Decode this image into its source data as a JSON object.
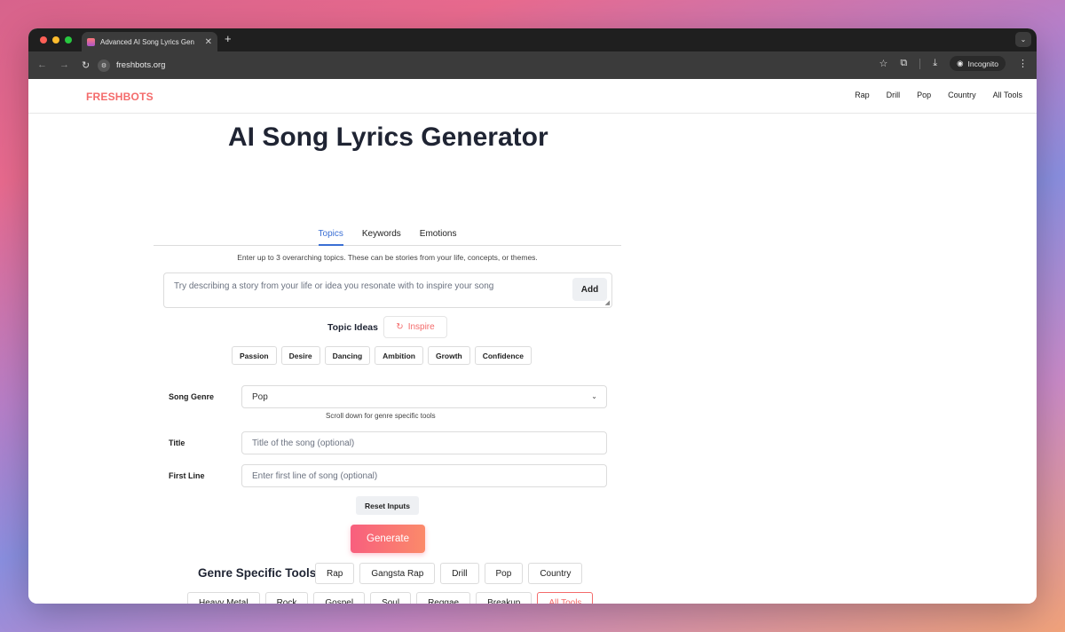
{
  "browser": {
    "tab_title": "Advanced AI Song Lyrics Gen",
    "url": "freshbots.org",
    "incognito_label": "Incognito"
  },
  "site": {
    "logo": "FRESHBOTS",
    "nav": [
      "Rap",
      "Drill",
      "Pop",
      "Country",
      "All Tools"
    ]
  },
  "page": {
    "title": "AI Song Lyrics Generator",
    "tabs": [
      "Topics",
      "Keywords",
      "Emotions"
    ],
    "active_tab": "Topics",
    "helper": "Enter up to 3 overarching topics. These can be stories from your life, concepts, or themes.",
    "topic_placeholder": "Try describing a story from your life or idea you resonate with to inspire your song",
    "add_label": "Add",
    "topic_ideas_label": "Topic Ideas",
    "inspire_label": "Inspire",
    "topic_chips": [
      "Passion",
      "Desire",
      "Dancing",
      "Ambition",
      "Growth",
      "Confidence"
    ]
  },
  "form": {
    "genre_label": "Song Genre",
    "genre_value": "Pop",
    "genre_hint": "Scroll down for genre specific tools",
    "title_label": "Title",
    "title_placeholder": "Title of the song (optional)",
    "first_line_label": "First Line",
    "first_line_placeholder": "Enter first line of song (optional)",
    "reset_label": "Reset Inputs",
    "generate_label": "Generate"
  },
  "genre_tools": {
    "title": "Genre Specific Tools",
    "row1": [
      "Rap",
      "Gangsta Rap",
      "Drill",
      "Pop",
      "Country"
    ],
    "row2": [
      "Heavy Metal",
      "Rock",
      "Gospel",
      "Soul",
      "Reggae",
      "Breakup",
      "All Tools"
    ]
  },
  "colors": {
    "brand": "#f46b6b",
    "active_tab": "#3b6fd4",
    "generate_gradient_start": "#f85f7e",
    "generate_gradient_end": "#fb8a6a"
  }
}
